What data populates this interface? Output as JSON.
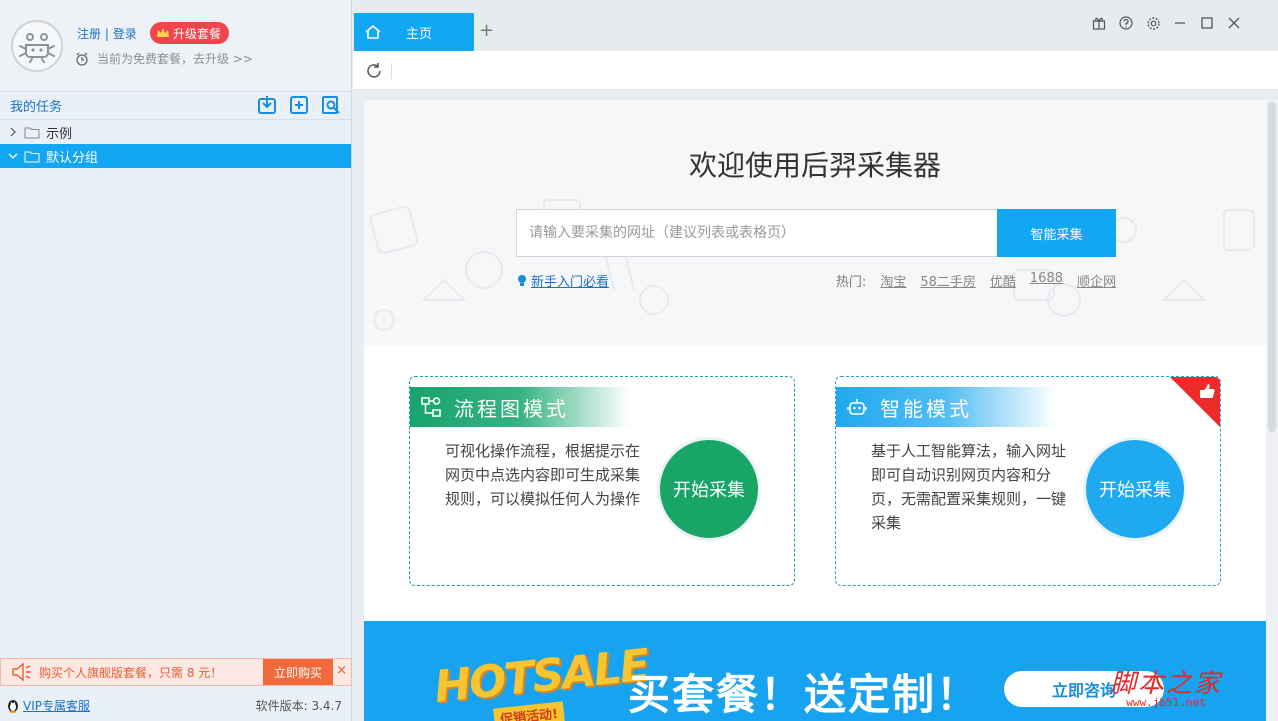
{
  "user": {
    "register_label": "注册",
    "login_label": "登录",
    "divider": " | ",
    "upgrade_badge": "升级套餐",
    "plan_text": "当前为免费套餐，去升级 >>"
  },
  "tasks": {
    "title": "我的任务",
    "tree": [
      {
        "label": "示例",
        "expanded": false,
        "selected": false
      },
      {
        "label": "默认分组",
        "expanded": true,
        "selected": true
      }
    ]
  },
  "promo": {
    "text": "购买个人旗舰版套餐，只需 8 元！",
    "buy_label": "立即购买",
    "close_glyph": "×"
  },
  "footer": {
    "vip_label": "VIP专属客服",
    "version": "软件版本: 3.4.7"
  },
  "tabs": {
    "home_label": "主页",
    "add_glyph": "+"
  },
  "hero": {
    "welcome": "欢迎使用后羿采集器",
    "url_placeholder": "请输入要采集的网址（建议列表或表格页）",
    "smart_button": "智能采集",
    "guide_link": "新手入门必看",
    "hot_label": "热门:",
    "hot_links": [
      "淘宝",
      "58二手房",
      "优酷",
      "1688",
      "顺企网"
    ]
  },
  "modes": {
    "flow": {
      "title": "流程图模式",
      "desc": "可视化操作流程，根据提示在网页中点选内容即可生成采集规则，可以模拟任何人为操作",
      "start": "开始采集"
    },
    "smart": {
      "title": "智能模式",
      "desc": "基于人工智能算法，输入网址即可自动识别网页内容和分页，无需配置采集规则，一键采集",
      "start": "开始采集"
    }
  },
  "banner": {
    "hotsale": "HOTSALE",
    "hotsale_sub": "促销活动!",
    "slogan": "买套餐！送定制！",
    "consult_button": "立即咨询"
  },
  "watermark": {
    "cn": "脚本之家",
    "url": "www.jb51.net"
  },
  "colors": {
    "accent": "#12a7f2",
    "flow_green": "#18a566",
    "smart_blue": "#1ea9f1",
    "promo_orange": "#f26a3c",
    "badge_red": "#f2444c"
  }
}
